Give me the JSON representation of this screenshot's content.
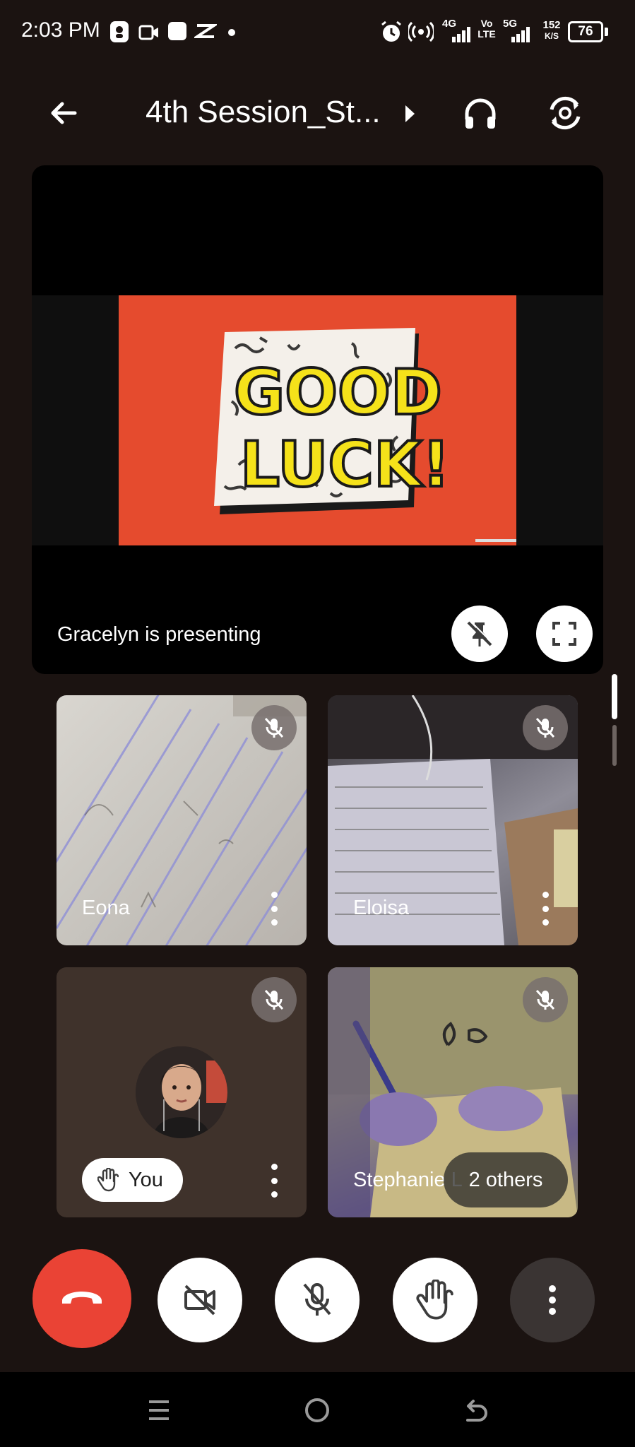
{
  "status_bar": {
    "time": "2:03 PM",
    "network_1": "4G",
    "volte": "Vo LTE",
    "network_2": "5G",
    "speed_value": "152",
    "speed_unit": "K/S",
    "battery": "76"
  },
  "header": {
    "title": "4th Session_St..."
  },
  "presentation": {
    "presenting_text": "Gracelyn is presenting",
    "slide_text_line1": "GOOD",
    "slide_text_line2": "LUCK!"
  },
  "participants": [
    {
      "name": "Eona",
      "muted": true
    },
    {
      "name": "Eloisa",
      "muted": true
    },
    {
      "name": "You",
      "muted": true,
      "hand_raised": true
    },
    {
      "name": "Stephanie L",
      "muted": true
    }
  ],
  "others_chip": "2 others",
  "controls": [
    "end-call",
    "camera-off",
    "mic-off",
    "raise-hand",
    "more-options"
  ],
  "colors": {
    "background": "#1b1311",
    "end_call": "#ea4335",
    "slide": "#e54b2e",
    "slide_text": "#f5e21a"
  }
}
